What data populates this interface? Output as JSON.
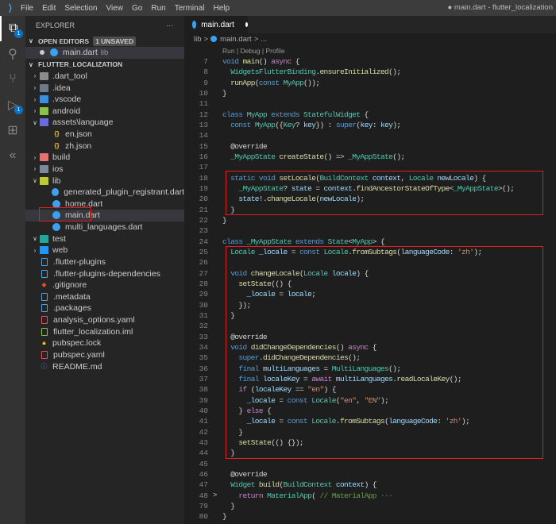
{
  "titlebar": {
    "menu": [
      "File",
      "Edit",
      "Selection",
      "View",
      "Go",
      "Run",
      "Terminal",
      "Help"
    ],
    "window_title": "● main.dart - flutter_localization"
  },
  "activity": [
    {
      "name": "explorer-icon",
      "glyph": "⧉",
      "badge": "1",
      "active": true
    },
    {
      "name": "search-icon",
      "glyph": "⚲"
    },
    {
      "name": "source-control-icon",
      "glyph": "⑂"
    },
    {
      "name": "run-debug-icon",
      "glyph": "▷",
      "badge": "1"
    },
    {
      "name": "extensions-icon",
      "glyph": "⊞"
    },
    {
      "name": "flutter-icon",
      "glyph": "«"
    }
  ],
  "sidebar": {
    "title": "EXPLORER",
    "more": "···",
    "open_editors": {
      "label": "OPEN EDITORS",
      "badge": "1 UNSAVED",
      "file": "main.dart",
      "dir": "lib"
    },
    "project": "FLUTTER_LOCALIZATION",
    "tree": [
      {
        "label": ".dart_tool",
        "type": "folder",
        "depth": 0,
        "chev": ">",
        "color": "#8c8c8c"
      },
      {
        "label": ".idea",
        "type": "folder",
        "depth": 0,
        "chev": ">",
        "color": "#6c7a89"
      },
      {
        "label": ".vscode",
        "type": "folder",
        "depth": 0,
        "chev": ">",
        "color": "#3b8fe0"
      },
      {
        "label": "android",
        "type": "folder",
        "depth": 0,
        "chev": ">",
        "color": "#8bc34a"
      },
      {
        "label": "assets\\language",
        "type": "folder",
        "depth": 0,
        "chev": "v",
        "color": "#6b6bd6"
      },
      {
        "label": "en.json",
        "type": "json",
        "depth": 1
      },
      {
        "label": "zh.json",
        "type": "json",
        "depth": 1
      },
      {
        "label": "build",
        "type": "folder",
        "depth": 0,
        "chev": ">",
        "color": "#e57373"
      },
      {
        "label": "ios",
        "type": "folder",
        "depth": 0,
        "chev": ">",
        "color": "#7a8a99"
      },
      {
        "label": "lib",
        "type": "folder",
        "depth": 0,
        "chev": "v",
        "color": "#c0ca33"
      },
      {
        "label": "generated_plugin_registrant.dart",
        "type": "dart",
        "depth": 1
      },
      {
        "label": "home.dart",
        "type": "dart",
        "depth": 1
      },
      {
        "label": "main.dart",
        "type": "dart",
        "depth": 1,
        "selected": true
      },
      {
        "label": "multi_languages.dart",
        "type": "dart",
        "depth": 1
      },
      {
        "label": "test",
        "type": "folder",
        "depth": 0,
        "chev": "v",
        "color": "#26a69a"
      },
      {
        "label": "web",
        "type": "folder",
        "depth": 0,
        "chev": ">",
        "color": "#2196f3"
      },
      {
        "label": ".flutter-plugins",
        "type": "file",
        "depth": 0,
        "color": "#5a9fd4"
      },
      {
        "label": ".flutter-plugins-dependencies",
        "type": "file",
        "depth": 0,
        "color": "#5a9fd4"
      },
      {
        "label": ".gitignore",
        "type": "git",
        "depth": 0,
        "color": "#e44d26"
      },
      {
        "label": ".metadata",
        "type": "file",
        "depth": 0,
        "color": "#5a9fd4"
      },
      {
        "label": ".packages",
        "type": "file",
        "depth": 0,
        "color": "#5a9fd4"
      },
      {
        "label": "analysis_options.yaml",
        "type": "file",
        "depth": 0,
        "color": "#e54d5c"
      },
      {
        "label": "flutter_localization.iml",
        "type": "file",
        "depth": 0,
        "color": "#8bc34a"
      },
      {
        "label": "pubspec.lock",
        "type": "lock",
        "depth": 0,
        "color": "#f5d33c"
      },
      {
        "label": "pubspec.yaml",
        "type": "file",
        "depth": 0,
        "color": "#e54d5c"
      },
      {
        "label": "README.md",
        "type": "info",
        "depth": 0,
        "color": "#3b8fe0"
      }
    ]
  },
  "editor": {
    "tab": "main.dart",
    "breadcrumb": [
      "lib",
      ">",
      "main.dart",
      ">",
      "..."
    ],
    "codelens": "Run | Debug | Profile",
    "lines": [
      {
        "n": "7",
        "t": [
          [
            "void ",
            "k"
          ],
          [
            "main",
            "f"
          ],
          [
            "() ",
            "p"
          ],
          [
            "async",
            "c"
          ],
          [
            " {",
            "p"
          ]
        ]
      },
      {
        "n": "8",
        "t": [
          [
            "  WidgetsFlutterBinding",
            "t"
          ],
          [
            ".",
            "p"
          ],
          [
            "ensureInitialized",
            "f"
          ],
          [
            "();",
            "p"
          ]
        ]
      },
      {
        "n": "9",
        "t": [
          [
            "  runApp",
            "f"
          ],
          [
            "(",
            "p"
          ],
          [
            "const",
            "k"
          ],
          [
            " MyApp",
            "t"
          ],
          [
            "());",
            "p"
          ]
        ]
      },
      {
        "n": "10",
        "t": [
          [
            "}",
            "p"
          ]
        ]
      },
      {
        "n": "11",
        "t": []
      },
      {
        "n": "12",
        "t": [
          [
            "class ",
            "k"
          ],
          [
            "MyApp ",
            "t"
          ],
          [
            "extends ",
            "k"
          ],
          [
            "StatefulWidget",
            "t"
          ],
          [
            " {",
            "p"
          ]
        ]
      },
      {
        "n": "13",
        "t": [
          [
            "  const ",
            "k"
          ],
          [
            "MyApp",
            "t"
          ],
          [
            "({",
            "p"
          ],
          [
            "Key",
            "t"
          ],
          [
            "? ",
            "p"
          ],
          [
            "key",
            "v"
          ],
          [
            "}) : ",
            "p"
          ],
          [
            "super",
            "k"
          ],
          [
            "(",
            "p"
          ],
          [
            "key",
            "v"
          ],
          [
            ": ",
            "p"
          ],
          [
            "key",
            "v"
          ],
          [
            ");",
            "p"
          ]
        ]
      },
      {
        "n": "14",
        "t": []
      },
      {
        "n": "15",
        "t": [
          [
            "  @override",
            "p"
          ]
        ]
      },
      {
        "n": "16",
        "t": [
          [
            "  _MyAppState ",
            "t"
          ],
          [
            "createState",
            "f"
          ],
          [
            "() => ",
            "p"
          ],
          [
            "_MyAppState",
            "t"
          ],
          [
            "();",
            "p"
          ]
        ]
      },
      {
        "n": "17",
        "t": []
      },
      {
        "n": "18",
        "t": [
          [
            "  static void ",
            "k"
          ],
          [
            "setLocale",
            "f"
          ],
          [
            "(",
            "p"
          ],
          [
            "BuildContext ",
            "t"
          ],
          [
            "context",
            "v"
          ],
          [
            ", ",
            "p"
          ],
          [
            "Locale ",
            "t"
          ],
          [
            "newLocale",
            "v"
          ],
          [
            ") {",
            "p"
          ]
        ]
      },
      {
        "n": "19",
        "t": [
          [
            "    _MyAppState",
            "t"
          ],
          [
            "? ",
            "p"
          ],
          [
            "state",
            "v"
          ],
          [
            " = ",
            "p"
          ],
          [
            "context",
            "v"
          ],
          [
            ".",
            "p"
          ],
          [
            "findAncestorStateOfType",
            "f"
          ],
          [
            "<",
            "p"
          ],
          [
            "_MyAppState",
            "t"
          ],
          [
            ">();",
            "p"
          ]
        ]
      },
      {
        "n": "20",
        "t": [
          [
            "    state",
            "v"
          ],
          [
            "!.",
            "p"
          ],
          [
            "changeLocale",
            "f"
          ],
          [
            "(",
            "p"
          ],
          [
            "newLocale",
            "v"
          ],
          [
            ");",
            "p"
          ]
        ]
      },
      {
        "n": "21",
        "t": [
          [
            "  }",
            "p"
          ]
        ]
      },
      {
        "n": "22",
        "t": [
          [
            "}",
            "p"
          ]
        ]
      },
      {
        "n": "23",
        "t": []
      },
      {
        "n": "24",
        "t": [
          [
            "class ",
            "k"
          ],
          [
            "_MyAppState ",
            "t"
          ],
          [
            "extends ",
            "k"
          ],
          [
            "State",
            "t"
          ],
          [
            "<",
            "p"
          ],
          [
            "MyApp",
            "t"
          ],
          [
            "> {",
            "p"
          ]
        ]
      },
      {
        "n": "25",
        "t": [
          [
            "  Locale ",
            "t"
          ],
          [
            "_locale",
            "v"
          ],
          [
            " = ",
            "p"
          ],
          [
            "const ",
            "k"
          ],
          [
            "Locale",
            "t"
          ],
          [
            ".",
            "p"
          ],
          [
            "fromSubtags",
            "f"
          ],
          [
            "(",
            "p"
          ],
          [
            "languageCode",
            "v"
          ],
          [
            ": ",
            "p"
          ],
          [
            "'zh'",
            "s"
          ],
          [
            ");",
            "p"
          ]
        ]
      },
      {
        "n": "26",
        "t": []
      },
      {
        "n": "27",
        "t": [
          [
            "  void ",
            "k"
          ],
          [
            "changeLocale",
            "f"
          ],
          [
            "(",
            "p"
          ],
          [
            "Locale ",
            "t"
          ],
          [
            "locale",
            "v"
          ],
          [
            ") {",
            "p"
          ]
        ]
      },
      {
        "n": "28",
        "t": [
          [
            "    setState",
            "f"
          ],
          [
            "(() {",
            "p"
          ]
        ]
      },
      {
        "n": "29",
        "t": [
          [
            "      _locale",
            "v"
          ],
          [
            " = ",
            "p"
          ],
          [
            "locale",
            "v"
          ],
          [
            ";",
            "p"
          ]
        ]
      },
      {
        "n": "30",
        "t": [
          [
            "    });",
            "p"
          ]
        ]
      },
      {
        "n": "31",
        "t": [
          [
            "  }",
            "p"
          ]
        ]
      },
      {
        "n": "32",
        "t": []
      },
      {
        "n": "33",
        "t": [
          [
            "  @override",
            "p"
          ]
        ]
      },
      {
        "n": "34",
        "t": [
          [
            "  void ",
            "k"
          ],
          [
            "didChangeDependencies",
            "f"
          ],
          [
            "() ",
            "p"
          ],
          [
            "async",
            "c"
          ],
          [
            " {",
            "p"
          ]
        ]
      },
      {
        "n": "35",
        "t": [
          [
            "    super",
            "k"
          ],
          [
            ".",
            "p"
          ],
          [
            "didChangeDependencies",
            "f"
          ],
          [
            "();",
            "p"
          ]
        ]
      },
      {
        "n": "36",
        "t": [
          [
            "    final ",
            "k"
          ],
          [
            "multiLanguages",
            "v"
          ],
          [
            " = ",
            "p"
          ],
          [
            "MultiLanguages",
            "t"
          ],
          [
            "();",
            "p"
          ]
        ]
      },
      {
        "n": "37",
        "t": [
          [
            "    final ",
            "k"
          ],
          [
            "localeKey",
            "v"
          ],
          [
            " = ",
            "p"
          ],
          [
            "await ",
            "c"
          ],
          [
            "multiLanguages",
            "v"
          ],
          [
            ".",
            "p"
          ],
          [
            "readLocaleKey",
            "f"
          ],
          [
            "();",
            "p"
          ]
        ]
      },
      {
        "n": "38",
        "t": [
          [
            "    if ",
            "c"
          ],
          [
            "(",
            "p"
          ],
          [
            "localeKey",
            "v"
          ],
          [
            " == ",
            "p"
          ],
          [
            "\"en\"",
            "s"
          ],
          [
            ") {",
            "p"
          ]
        ]
      },
      {
        "n": "39",
        "t": [
          [
            "      _locale",
            "v"
          ],
          [
            " = ",
            "p"
          ],
          [
            "const ",
            "k"
          ],
          [
            "Locale",
            "t"
          ],
          [
            "(",
            "p"
          ],
          [
            "\"en\"",
            "s"
          ],
          [
            ", ",
            "p"
          ],
          [
            "\"EN\"",
            "s"
          ],
          [
            ");",
            "p"
          ]
        ]
      },
      {
        "n": "40",
        "t": [
          [
            "    } ",
            "p"
          ],
          [
            "else",
            "c"
          ],
          [
            " {",
            "p"
          ]
        ]
      },
      {
        "n": "41",
        "t": [
          [
            "      _locale",
            "v"
          ],
          [
            " = ",
            "p"
          ],
          [
            "const ",
            "k"
          ],
          [
            "Locale",
            "t"
          ],
          [
            ".",
            "p"
          ],
          [
            "fromSubtags",
            "f"
          ],
          [
            "(",
            "p"
          ],
          [
            "languageCode",
            "v"
          ],
          [
            ": ",
            "p"
          ],
          [
            "'zh'",
            "s"
          ],
          [
            ");",
            "p"
          ]
        ]
      },
      {
        "n": "42",
        "t": [
          [
            "    }",
            "p"
          ]
        ]
      },
      {
        "n": "43",
        "t": [
          [
            "    setState",
            "f"
          ],
          [
            "(() {});",
            "p"
          ]
        ]
      },
      {
        "n": "44",
        "t": [
          [
            "  }",
            "p"
          ]
        ]
      },
      {
        "n": "45",
        "t": []
      },
      {
        "n": "46",
        "t": [
          [
            "  @override",
            "p"
          ]
        ]
      },
      {
        "n": "47",
        "t": [
          [
            "  Widget ",
            "t"
          ],
          [
            "build",
            "f"
          ],
          [
            "(",
            "p"
          ],
          [
            "BuildContext ",
            "t"
          ],
          [
            "context",
            "v"
          ],
          [
            ") {",
            "p"
          ]
        ]
      },
      {
        "n": "48",
        "fold": ">",
        "t": [
          [
            "    return ",
            "c"
          ],
          [
            "MaterialApp",
            "t"
          ],
          [
            "( ",
            "p"
          ],
          [
            "// MaterialApp",
            "m"
          ],
          [
            " ···",
            "g"
          ]
        ]
      },
      {
        "n": "79",
        "t": [
          [
            "  }",
            "p"
          ]
        ]
      },
      {
        "n": "80",
        "t": [
          [
            "}",
            "p"
          ]
        ]
      }
    ]
  },
  "colors": {
    "highlight_box": "#e01e1e",
    "accent": "#0e70c0"
  }
}
